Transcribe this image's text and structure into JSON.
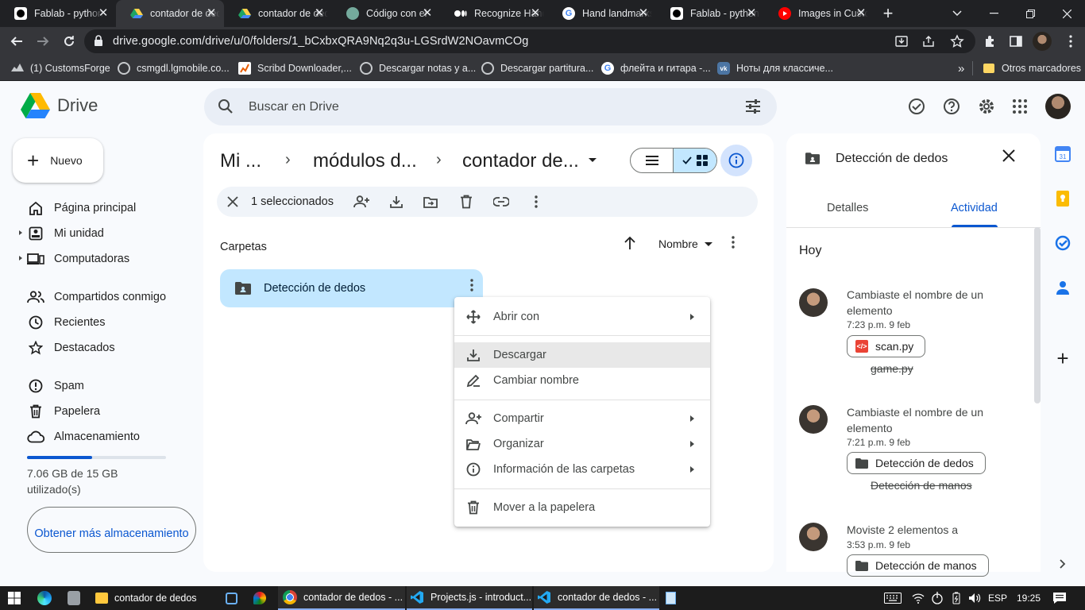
{
  "browser": {
    "tabs": [
      {
        "title": "Fablab - python",
        "icon": "github-icon"
      },
      {
        "title": "contador de dedos",
        "icon": "google-drive-icon",
        "active": true
      },
      {
        "title": "contador de dedos",
        "icon": "google-drive-icon"
      },
      {
        "title": "Código con el",
        "icon": "chatgpt-icon"
      },
      {
        "title": "Recognize Hand",
        "icon": "medium-icon"
      },
      {
        "title": "Hand landmarks",
        "icon": "google-icon"
      },
      {
        "title": "Fablab - python",
        "icon": "github-icon"
      },
      {
        "title": "Images in Custom",
        "icon": "youtube-icon"
      }
    ],
    "url": "drive.google.com/drive/u/0/folders/1_bCxbxQRA9Nq2q3u-LGSrdW2NOavmCOg",
    "bookmarks": [
      {
        "label": "(1) CustomsForge",
        "icon": "customsforge-icon"
      },
      {
        "label": "csmgdl.lgmobile.co...",
        "icon": "globe-icon"
      },
      {
        "label": "Scribd Downloader,...",
        "icon": "scribd-icon"
      },
      {
        "label": "Descargar notas y a...",
        "icon": "globe-icon"
      },
      {
        "label": "Descargar partitura...",
        "icon": "globe-icon"
      },
      {
        "label": "флейта и гитара -...",
        "icon": "google-icon"
      },
      {
        "label": "Ноты для классиче...",
        "icon": "vk-icon"
      }
    ],
    "bookmarks_more": "»",
    "other_bookmarks": "Otros marcadores"
  },
  "drive": {
    "app_name": "Drive",
    "search_placeholder": "Buscar en Drive",
    "new_label": "Nuevo",
    "nav": [
      {
        "label": "Página principal",
        "icon": "home-icon",
        "expandable": false
      },
      {
        "label": "Mi unidad",
        "icon": "my-drive-icon",
        "expandable": true
      },
      {
        "label": "Computadoras",
        "icon": "computers-icon",
        "expandable": true
      },
      {
        "label": "Compartidos conmigo",
        "icon": "shared-icon",
        "expandable": false
      },
      {
        "label": "Recientes",
        "icon": "recent-icon",
        "expandable": false
      },
      {
        "label": "Destacados",
        "icon": "star-icon",
        "expandable": false
      },
      {
        "label": "Spam",
        "icon": "spam-icon",
        "expandable": false
      },
      {
        "label": "Papelera",
        "icon": "trash-icon",
        "expandable": false
      },
      {
        "label": "Almacenamiento",
        "icon": "cloud-icon",
        "expandable": false
      }
    ],
    "storage": {
      "text": "7.06 GB de 15 GB utilizado(s)",
      "used_fraction": 0.47
    },
    "storage_button": "Obtener más almacenamiento",
    "breadcrumb": [
      "Mi ...",
      "módulos d...",
      "contador de..."
    ],
    "breadcrumb_sep": "›",
    "selection_label": "1 seleccionados",
    "section_folders": "Carpetas",
    "sort_label": "Nombre",
    "folder": {
      "name": "Detección de dedos"
    },
    "context_menu": [
      {
        "label": "Abrir con",
        "icon": "open-with-icon",
        "submenu": true
      },
      {
        "label": "Descargar",
        "icon": "download-icon",
        "submenu": false,
        "highlighted": true
      },
      {
        "label": "Cambiar nombre",
        "icon": "rename-icon",
        "submenu": false
      },
      {
        "label": "Compartir",
        "icon": "share-icon",
        "submenu": true
      },
      {
        "label": "Organizar",
        "icon": "organize-icon",
        "submenu": true
      },
      {
        "label": "Información de las carpetas",
        "icon": "info-icon",
        "submenu": true
      },
      {
        "label": "Mover a la papelera",
        "icon": "trash-icon",
        "submenu": false
      }
    ]
  },
  "details": {
    "title": "Detección de dedos",
    "tabs": [
      "Detalles",
      "Actividad"
    ],
    "active_tab": "Actividad",
    "day_label": "Hoy",
    "activities": [
      {
        "text": "Cambiaste el nombre de un elemento",
        "time": "7:23 p.m. 9 feb",
        "chip": "scan.py",
        "chip_icon": "python-file-icon",
        "old": "game.py"
      },
      {
        "text": "Cambiaste el nombre de un elemento",
        "time": "7:21 p.m. 9 feb",
        "chip": "Detección de dedos",
        "chip_icon": "folder-icon",
        "old": "Detección de manos"
      },
      {
        "text": "Moviste 2 elementos a",
        "time": "3:53 p.m. 9 feb",
        "chip": "Detección de manos",
        "chip_icon": "folder-icon",
        "old": ""
      }
    ]
  },
  "taskbar": {
    "items": [
      {
        "label": "",
        "icon": "edge-icon"
      },
      {
        "label": "",
        "icon": "storage-app-icon"
      },
      {
        "label": "contador de dedos",
        "icon": "file-explorer-icon"
      },
      {
        "label": "",
        "icon": "capture-icon"
      },
      {
        "label": "",
        "icon": "paint-icon"
      },
      {
        "label": "contador de dedos - ...",
        "icon": "chrome-icon"
      },
      {
        "label": "Projects.js - introduct...",
        "icon": "vscode-icon"
      },
      {
        "label": "contador de dedos - ...",
        "icon": "vscode-icon"
      },
      {
        "label": "",
        "icon": "notepad-icon"
      }
    ],
    "language": "ESP",
    "clock": "19:25"
  }
}
